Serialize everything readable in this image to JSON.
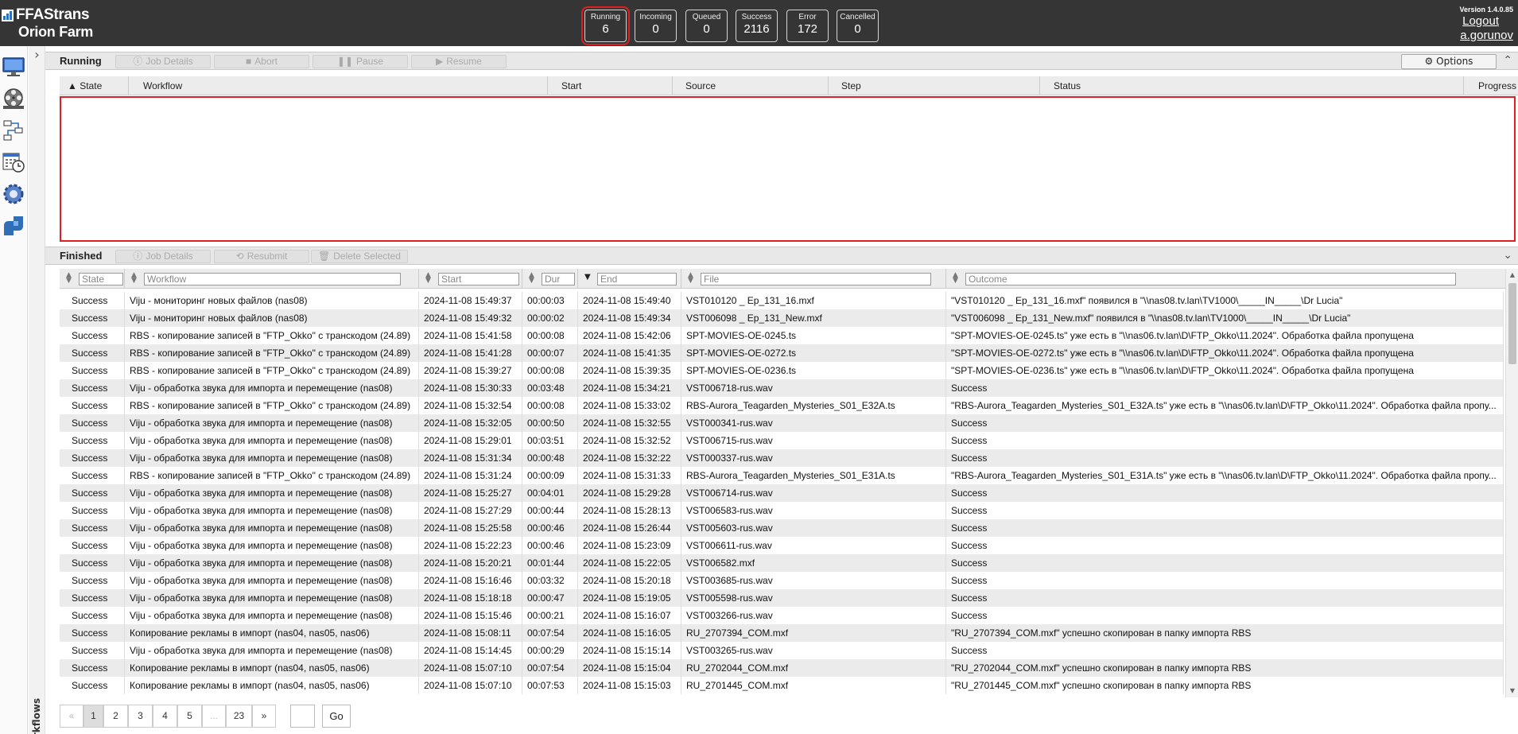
{
  "app": {
    "logo_line1": "FFAStrans",
    "logo_line2": "Orion Farm",
    "version": "Version 1.4.0.85",
    "logout": "Logout",
    "username": "a.gorunov"
  },
  "counters": [
    {
      "label": "Running",
      "value": "6"
    },
    {
      "label": "Incoming",
      "value": "0"
    },
    {
      "label": "Queued",
      "value": "0"
    },
    {
      "label": "Success",
      "value": "2116"
    },
    {
      "label": "Error",
      "value": "172"
    },
    {
      "label": "Cancelled",
      "value": "0"
    }
  ],
  "nav_icons": [
    "monitor-icon",
    "film-reel-icon",
    "workflow-nodes-icon",
    "scheduler-icon",
    "settings-gear-icon",
    "ffastrans-logo-icon"
  ],
  "sidebar": {
    "workflows_label": "Workflows"
  },
  "running": {
    "title": "Running",
    "buttons": {
      "job_details": "Job Details",
      "abort": "Abort",
      "pause": "Pause",
      "resume": "Resume"
    },
    "options": "Options",
    "columns": {
      "state": "State",
      "workflow": "Workflow",
      "start": "Start",
      "source": "Source",
      "step": "Step",
      "status": "Status",
      "progress": "Progress"
    }
  },
  "finished": {
    "title": "Finished",
    "buttons": {
      "job_details": "Job Details",
      "resubmit": "Resubmit",
      "delete_selected": "Delete Selected"
    },
    "filter_placeholders": {
      "state": "State",
      "workflow": "Workflow",
      "start": "Start",
      "dur": "Dur",
      "end": "End",
      "file": "File",
      "outcome": "Outcome"
    },
    "rows": [
      [
        "Success",
        "Viju - мониторинг новых файлов (nas08)",
        "2024-11-08 15:49:37",
        "00:00:03",
        "2024-11-08 15:49:40",
        "VST010120 _ Ep_131_16.mxf",
        "\"VST010120 _ Ep_131_16.mxf\" появился в \"\\\\nas08.tv.lan\\TV1000\\_____IN_____\\Dr Lucia\""
      ],
      [
        "Success",
        "Viju - мониторинг новых файлов (nas08)",
        "2024-11-08 15:49:32",
        "00:00:02",
        "2024-11-08 15:49:34",
        "VST006098 _ Ep_131_New.mxf",
        "\"VST006098 _ Ep_131_New.mxf\" появился в \"\\\\nas08.tv.lan\\TV1000\\_____IN_____\\Dr Lucia\""
      ],
      [
        "Success",
        "RBS - копирование записей в \"FTP_Okko\" с транскодом (24.89)",
        "2024-11-08 15:41:58",
        "00:00:08",
        "2024-11-08 15:42:06",
        "SPT-MOVIES-OE-0245.ts",
        "\"SPT-MOVIES-OE-0245.ts\" уже есть в \"\\\\nas06.tv.lan\\D\\FTP_Okko\\11.2024\". Обработка файла пропущена"
      ],
      [
        "Success",
        "RBS - копирование записей в \"FTP_Okko\" с транскодом (24.89)",
        "2024-11-08 15:41:28",
        "00:00:07",
        "2024-11-08 15:41:35",
        "SPT-MOVIES-OE-0272.ts",
        "\"SPT-MOVIES-OE-0272.ts\" уже есть в \"\\\\nas06.tv.lan\\D\\FTP_Okko\\11.2024\". Обработка файла пропущена"
      ],
      [
        "Success",
        "RBS - копирование записей в \"FTP_Okko\" с транскодом (24.89)",
        "2024-11-08 15:39:27",
        "00:00:08",
        "2024-11-08 15:39:35",
        "SPT-MOVIES-OE-0236.ts",
        "\"SPT-MOVIES-OE-0236.ts\" уже есть в \"\\\\nas06.tv.lan\\D\\FTP_Okko\\11.2024\". Обработка файла пропущена"
      ],
      [
        "Success",
        "Viju - обработка звука для импорта и перемещение (nas08)",
        "2024-11-08 15:30:33",
        "00:03:48",
        "2024-11-08 15:34:21",
        "VST006718-rus.wav",
        "Success"
      ],
      [
        "Success",
        "RBS - копирование записей в \"FTP_Okko\" с транскодом (24.89)",
        "2024-11-08 15:32:54",
        "00:00:08",
        "2024-11-08 15:33:02",
        "RBS-Aurora_Teagarden_Mysteries_S01_E32A.ts",
        "\"RBS-Aurora_Teagarden_Mysteries_S01_E32A.ts\" уже есть в \"\\\\nas06.tv.lan\\D\\FTP_Okko\\11.2024\". Обработка файла пропу..."
      ],
      [
        "Success",
        "Viju - обработка звука для импорта и перемещение (nas08)",
        "2024-11-08 15:32:05",
        "00:00:50",
        "2024-11-08 15:32:55",
        "VST000341-rus.wav",
        "Success"
      ],
      [
        "Success",
        "Viju - обработка звука для импорта и перемещение (nas08)",
        "2024-11-08 15:29:01",
        "00:03:51",
        "2024-11-08 15:32:52",
        "VST006715-rus.wav",
        "Success"
      ],
      [
        "Success",
        "Viju - обработка звука для импорта и перемещение (nas08)",
        "2024-11-08 15:31:34",
        "00:00:48",
        "2024-11-08 15:32:22",
        "VST000337-rus.wav",
        "Success"
      ],
      [
        "Success",
        "RBS - копирование записей в \"FTP_Okko\" с транскодом (24.89)",
        "2024-11-08 15:31:24",
        "00:00:09",
        "2024-11-08 15:31:33",
        "RBS-Aurora_Teagarden_Mysteries_S01_E31A.ts",
        "\"RBS-Aurora_Teagarden_Mysteries_S01_E31A.ts\" уже есть в \"\\\\nas06.tv.lan\\D\\FTP_Okko\\11.2024\". Обработка файла пропу..."
      ],
      [
        "Success",
        "Viju - обработка звука для импорта и перемещение (nas08)",
        "2024-11-08 15:25:27",
        "00:04:01",
        "2024-11-08 15:29:28",
        "VST006714-rus.wav",
        "Success"
      ],
      [
        "Success",
        "Viju - обработка звука для импорта и перемещение (nas08)",
        "2024-11-08 15:27:29",
        "00:00:44",
        "2024-11-08 15:28:13",
        "VST006583-rus.wav",
        "Success"
      ],
      [
        "Success",
        "Viju - обработка звука для импорта и перемещение (nas08)",
        "2024-11-08 15:25:58",
        "00:00:46",
        "2024-11-08 15:26:44",
        "VST005603-rus.wav",
        "Success"
      ],
      [
        "Success",
        "Viju - обработка звука для импорта и перемещение (nas08)",
        "2024-11-08 15:22:23",
        "00:00:46",
        "2024-11-08 15:23:09",
        "VST006611-rus.wav",
        "Success"
      ],
      [
        "Success",
        "Viju - обработка звука для импорта и перемещение (nas08)",
        "2024-11-08 15:20:21",
        "00:01:44",
        "2024-11-08 15:22:05",
        "VST006582.mxf",
        "Success"
      ],
      [
        "Success",
        "Viju - обработка звука для импорта и перемещение (nas08)",
        "2024-11-08 15:16:46",
        "00:03:32",
        "2024-11-08 15:20:18",
        "VST003685-rus.wav",
        "Success"
      ],
      [
        "Success",
        "Viju - обработка звука для импорта и перемещение (nas08)",
        "2024-11-08 15:18:18",
        "00:00:47",
        "2024-11-08 15:19:05",
        "VST005598-rus.wav",
        "Success"
      ],
      [
        "Success",
        "Viju - обработка звука для импорта и перемещение (nas08)",
        "2024-11-08 15:15:46",
        "00:00:21",
        "2024-11-08 15:16:07",
        "VST003266-rus.wav",
        "Success"
      ],
      [
        "Success",
        "Копирование рекламы в импорт (nas04, nas05, nas06)",
        "2024-11-08 15:08:11",
        "00:07:54",
        "2024-11-08 15:16:05",
        "RU_2707394_COM.mxf",
        "\"RU_2707394_COM.mxf\" успешно скопирован в папку импорта RBS"
      ],
      [
        "Success",
        "Viju - обработка звука для импорта и перемещение (nas08)",
        "2024-11-08 15:14:45",
        "00:00:29",
        "2024-11-08 15:15:14",
        "VST003265-rus.wav",
        "Success"
      ],
      [
        "Success",
        "Копирование рекламы в импорт (nas04, nas05, nas06)",
        "2024-11-08 15:07:10",
        "00:07:54",
        "2024-11-08 15:15:04",
        "RU_2702044_COM.mxf",
        "\"RU_2702044_COM.mxf\" успешно скопирован в папку импорта RBS"
      ],
      [
        "Success",
        "Копирование рекламы в импорт (nas04, nas05, nas06)",
        "2024-11-08 15:07:10",
        "00:07:53",
        "2024-11-08 15:15:03",
        "RU_2701445_COM.mxf",
        "\"RU_2701445_COM.mxf\" успешно скопирован в папку импорта RBS"
      ]
    ]
  },
  "pager": {
    "prev": "«",
    "pages": [
      "1",
      "2",
      "3",
      "4",
      "5",
      "...",
      "23"
    ],
    "next": "»",
    "go": "Go"
  },
  "colors": {
    "topbar": "#353535",
    "highlight": "#e02020",
    "row_alt": "#ebebeb",
    "brand_blue": "#2f6fb8"
  }
}
